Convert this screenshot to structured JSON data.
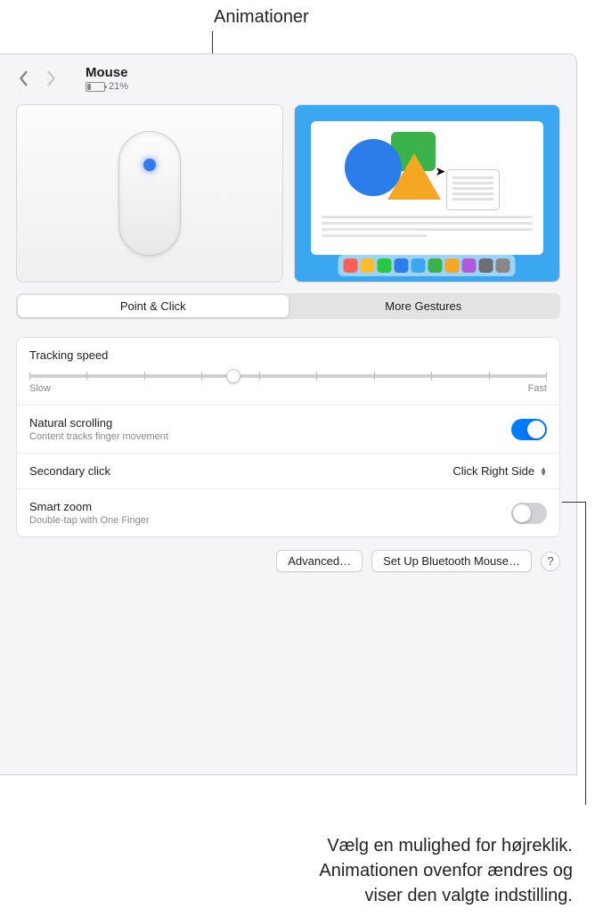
{
  "annotations": {
    "top": "Animationer",
    "bottom_line1": "Vælg en mulighed for højreklik.",
    "bottom_line2": "Animationen ovenfor ændres og",
    "bottom_line3": "viser den valgte indstilling."
  },
  "header": {
    "title": "Mouse",
    "battery_percent": "21%"
  },
  "tabs": {
    "point_click": "Point & Click",
    "more_gestures": "More Gestures"
  },
  "settings": {
    "tracking_speed": {
      "label": "Tracking speed",
      "slow": "Slow",
      "fast": "Fast"
    },
    "natural_scrolling": {
      "label": "Natural scrolling",
      "sub": "Content tracks finger movement",
      "enabled": true
    },
    "secondary_click": {
      "label": "Secondary click",
      "value": "Click Right Side"
    },
    "smart_zoom": {
      "label": "Smart zoom",
      "sub": "Double-tap with One Finger",
      "enabled": false
    }
  },
  "buttons": {
    "advanced": "Advanced…",
    "bluetooth": "Set Up Bluetooth Mouse…",
    "help": "?"
  },
  "dock_colors": [
    "#ff5f57",
    "#ffbd2e",
    "#28c840",
    "#2b7de9",
    "#3aa7f0",
    "#3bb24a",
    "#f5a623",
    "#b25bd8",
    "#6e6e73",
    "#888"
  ]
}
